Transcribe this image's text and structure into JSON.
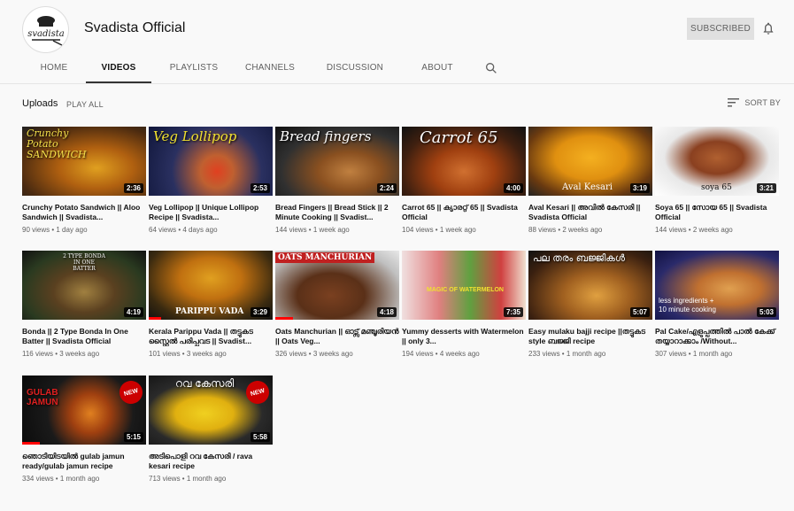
{
  "channel": {
    "name": "Svadista Official",
    "avatar_text": "svadista",
    "subscribe_label": "SUBSCRIBED"
  },
  "tabs": [
    {
      "label": "HOME"
    },
    {
      "label": "VIDEOS"
    },
    {
      "label": "PLAYLISTS"
    },
    {
      "label": "CHANNELS"
    },
    {
      "label": "DISCUSSION"
    },
    {
      "label": "ABOUT"
    }
  ],
  "uploads": {
    "title": "Uploads",
    "play_all": "PLAY ALL",
    "sort_by": "SORT BY"
  },
  "videos": [
    {
      "title": "Crunchy Potato Sandwich || Aloo Sandwich || Svadista...",
      "meta": "90 views • 1 day ago",
      "duration": "2:36",
      "thumb_text": "Crunchy Potato SANDWICH",
      "bottom_text": ""
    },
    {
      "title": "Veg Lollipop || Unique Lollipop Recipe || Svadista...",
      "meta": "64 views • 4 days ago",
      "duration": "2:53",
      "thumb_text": "Veg Lollipop",
      "bottom_text": ""
    },
    {
      "title": "Bread Fingers || Bread Stick || 2 Minute Cooking || Svadist...",
      "meta": "144 views • 1 week ago",
      "duration": "2:24",
      "thumb_text": "Bread fingers",
      "bottom_text": ""
    },
    {
      "title": "Carrot 65 || ക്യാരറ്റ് 65 || Svadista Official",
      "meta": "104 views • 1 week ago",
      "duration": "4:00",
      "thumb_text": "Carrot 65",
      "bottom_text": ""
    },
    {
      "title": "Aval Kesari || അവിൽ കേസരി || Svadista Official",
      "meta": "88 views • 2 weeks ago",
      "duration": "3:19",
      "thumb_text": "",
      "bottom_text": "Aval Kesari"
    },
    {
      "title": "Soya 65 || സോയ 65 || Svadista Official",
      "meta": "144 views • 2 weeks ago",
      "duration": "3:21",
      "thumb_text": "",
      "bottom_text": "soya 65"
    },
    {
      "title": "Bonda || 2 Type Bonda In One Batter || Svadista Official",
      "meta": "116 views • 3 weeks ago",
      "duration": "4:19",
      "thumb_text": "2 TYPE BONDA IN ONE BATTER",
      "bottom_text": ""
    },
    {
      "title": "Kerala Parippu Vada || തട്ടുകട സ്റ്റൈൽ പരിപ്പുവട || Svadist...",
      "meta": "101 views • 3 weeks ago",
      "duration": "3:29",
      "thumb_text": "",
      "bottom_text": "PARIPPU VADA"
    },
    {
      "title": "Oats Manchurian || ഓട്സ് മഞ്ചൂരിയൻ || Oats Veg...",
      "meta": "326 views • 3 weeks ago",
      "duration": "4:18",
      "thumb_text": "OATS MANCHURIAN",
      "bottom_text": ""
    },
    {
      "title": "Yummy desserts with Watermelon || only 3...",
      "meta": "194 views • 4 weeks ago",
      "duration": "7:35",
      "thumb_text": "",
      "bottom_text": "MAGIC OF WATERMELON"
    },
    {
      "title": "Easy mulaku bajji recipe ||തട്ടുകട style ബജ്ജി recipe",
      "meta": "233 views • 1 month ago",
      "duration": "5:07",
      "thumb_text": "പല തരം ബജ്ജികൾ",
      "bottom_text": ""
    },
    {
      "title": "Pal Cake/എളുപ്പത്തിൽ പാൽ കേക്ക് തയ്യാറാക്കാം /Without...",
      "meta": "307 views • 1 month ago",
      "duration": "5:03",
      "thumb_text": "",
      "bottom_text": "less ingredients + 10 minute cooking"
    },
    {
      "title": "ഞൊടിയിടയിൽ gulab jamun ready/gulab jamun recipe",
      "meta": "334 views • 1 month ago",
      "duration": "5:15",
      "thumb_text": "GULAB JAMUN",
      "bottom_text": ""
    },
    {
      "title": "അടിപൊളി റവ കേസരി / rava kesari recipe",
      "meta": "713 views • 1 month ago",
      "duration": "5:58",
      "thumb_text": "റവ കേസരി",
      "bottom_text": ""
    }
  ],
  "new_badge": "NEW",
  "colors": {
    "accent": "#ff0000",
    "subscribed_bg": "#e0e0e0",
    "background": "#f9f9f9"
  }
}
